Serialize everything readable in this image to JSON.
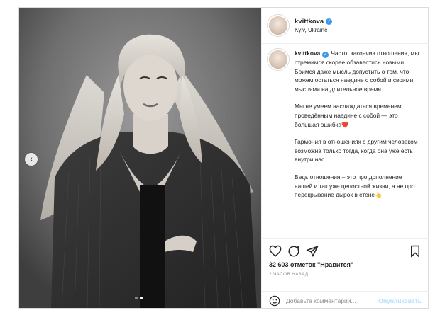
{
  "post": {
    "username": "kvittkova",
    "location": "Kyiv, Ukraine",
    "media": {
      "carousel_slides": 2,
      "active_slide": 2
    },
    "caption": {
      "username": "kvittkova",
      "paragraphs": [
        "Часто, закончив отношения, мы стремимся скорее обзавестись новыми. Боимся даже мысль допустить о том, что можем остаться наедине с собой и своими мыслями на длительное время.",
        "Мы не умеем наслаждаться временем, проведённым наедине с собой — это большая ошибка",
        "Гармония в отношениях с другим человеком возможна только тогда, когда она уже есть внутри нас.",
        "Ведь отношения – это про дополнение нашей и так уже целостной жизни, а не про перекрывание дырок в стене"
      ],
      "emoji": [
        "❤️",
        "👆"
      ]
    },
    "likes": "32 603 отметок \"Нравится\"",
    "time_ago": "2 ЧАСОВ НАЗАД",
    "comment_placeholder": "Добавьте комментарий...",
    "publish_label": "Опубликовать"
  },
  "colors": {
    "accent": "#0095f6",
    "publish_disabled": "#b2dffc",
    "verified": "#3897f0",
    "border": "#dbdbdb"
  },
  "icons": [
    "heart-icon",
    "comment-icon",
    "share-icon",
    "bookmark-icon",
    "smile-icon",
    "verified-badge-icon",
    "chevron-left-icon"
  ]
}
